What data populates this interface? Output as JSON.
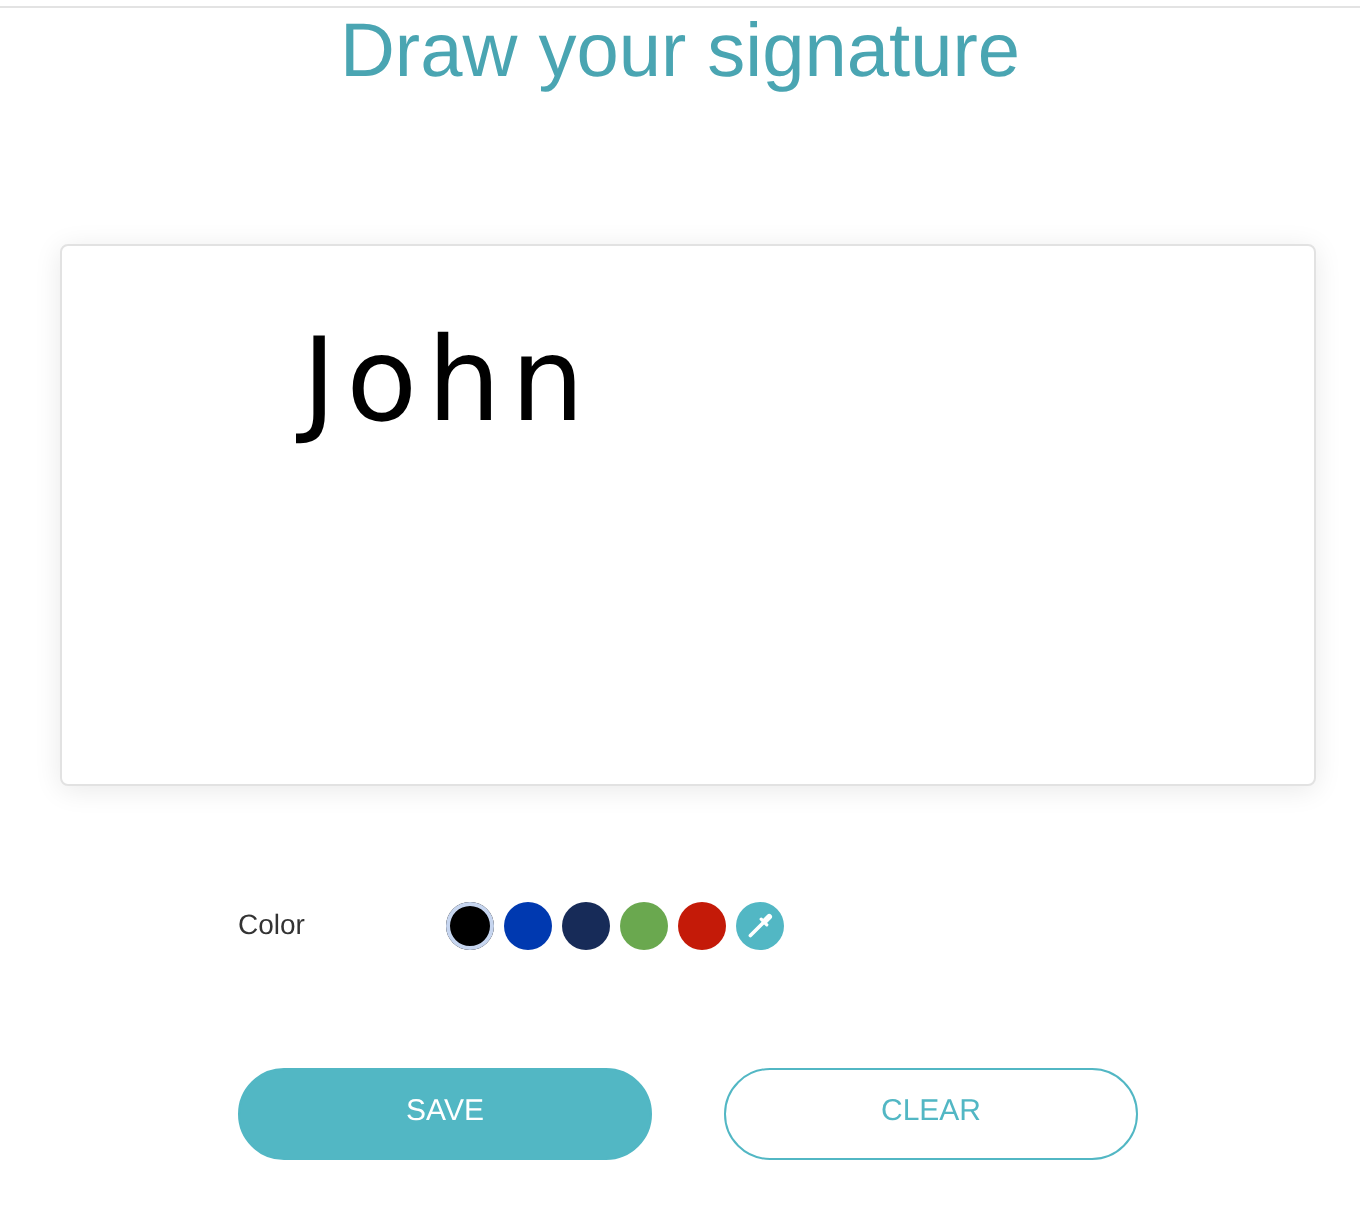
{
  "title": "Draw your signature",
  "signature_pad": {
    "signature": "John"
  },
  "color_picker": {
    "label": "Color",
    "swatches": [
      {
        "kind": "swatch",
        "color": "#000000",
        "selected": true
      },
      {
        "kind": "swatch",
        "color": "#0039b0",
        "selected": false
      },
      {
        "kind": "swatch",
        "color": "#172b58",
        "selected": false
      },
      {
        "kind": "swatch",
        "color": "#6aa84f",
        "selected": false
      },
      {
        "kind": "swatch",
        "color": "#c41a08",
        "selected": false
      },
      {
        "kind": "eyedropper",
        "selected": false
      }
    ]
  },
  "buttons": [
    {
      "label": "SAVE",
      "kind": "primary"
    },
    {
      "label": "CLEAR",
      "kind": "outline"
    }
  ]
}
